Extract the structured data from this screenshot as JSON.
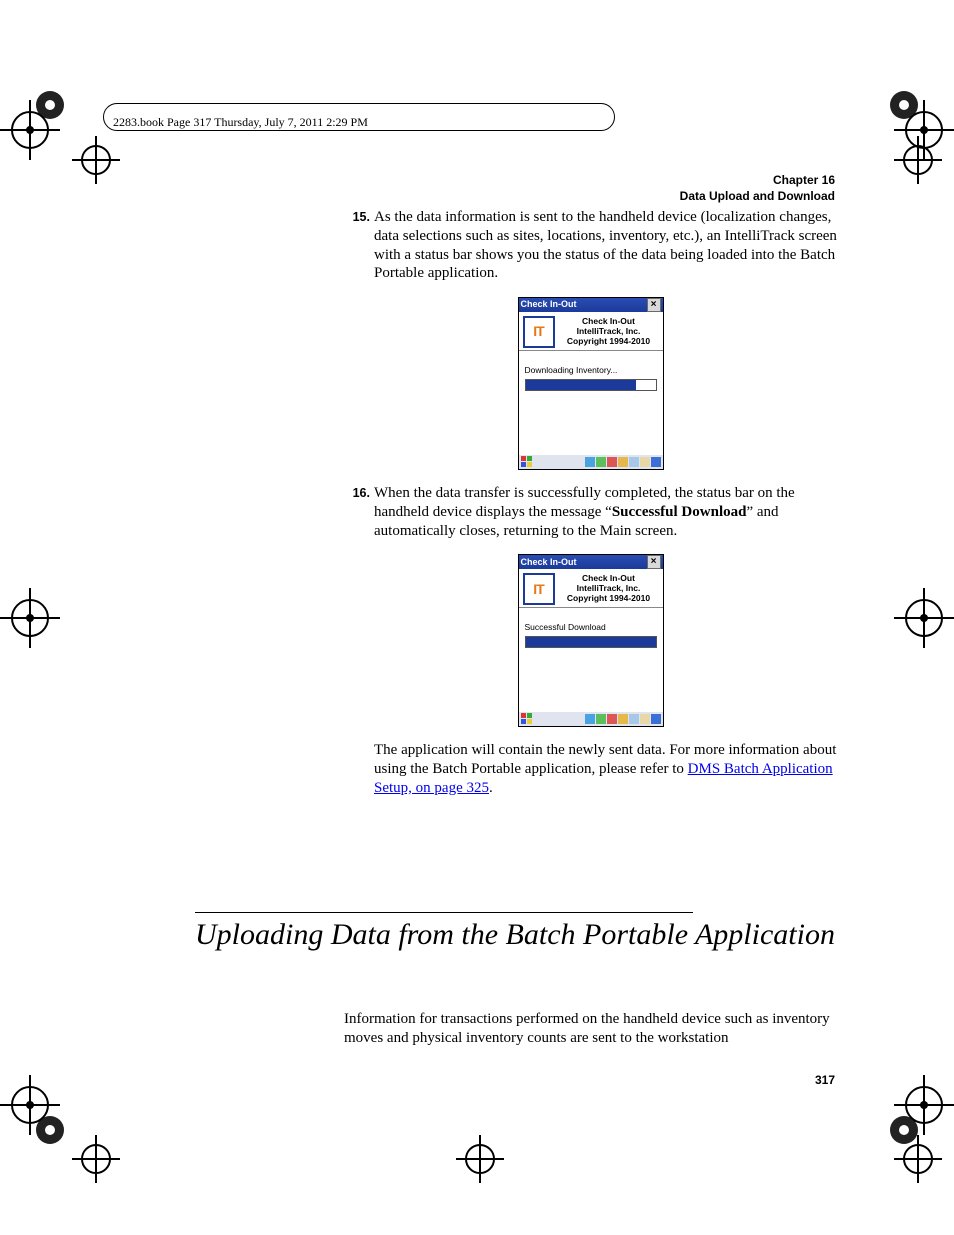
{
  "header_line": "2283.book  Page 317  Thursday, July 7, 2011  2:29 PM",
  "chapter": {
    "label": "Chapter 16",
    "title": "Data Upload and Download"
  },
  "item15": {
    "num": "15.",
    "text": "As the data information is sent to the handheld device (localization changes, data selections such as sites, locations, inventory, etc.), an IntelliTrack screen with a status bar shows you the status of the data being loaded into the Batch Portable application."
  },
  "item16": {
    "num": "16.",
    "text_a": "When the data transfer is successfully completed, the status bar on the handheld device displays the message “",
    "text_bold": "Successful Download",
    "text_b": "” and automatically closes, returning to the Main screen."
  },
  "follow_para": {
    "a": "The application will contain the newly sent data. For more information about using the Batch Portable application, please refer to ",
    "link": "DMS Batch Application Setup, on page 325",
    "b": "."
  },
  "section_title": "Uploading Data from the Batch Portable Application",
  "section_para": "Information for transactions performed on the handheld device such as inventory moves and physical inventory counts are sent to the workstation",
  "page_number": "317",
  "device_common": {
    "title": "Check In-Out",
    "banner_line1": "Check In-Out",
    "banner_line2": "IntelliTrack, Inc.",
    "banner_line3": "Copyright 1994-2010",
    "close_glyph": "×",
    "logo_text": "IT"
  },
  "device1": {
    "status": "Downloading Inventory...",
    "progress_pct": 85
  },
  "device2": {
    "status": "Successful Download",
    "progress_pct": 100
  }
}
